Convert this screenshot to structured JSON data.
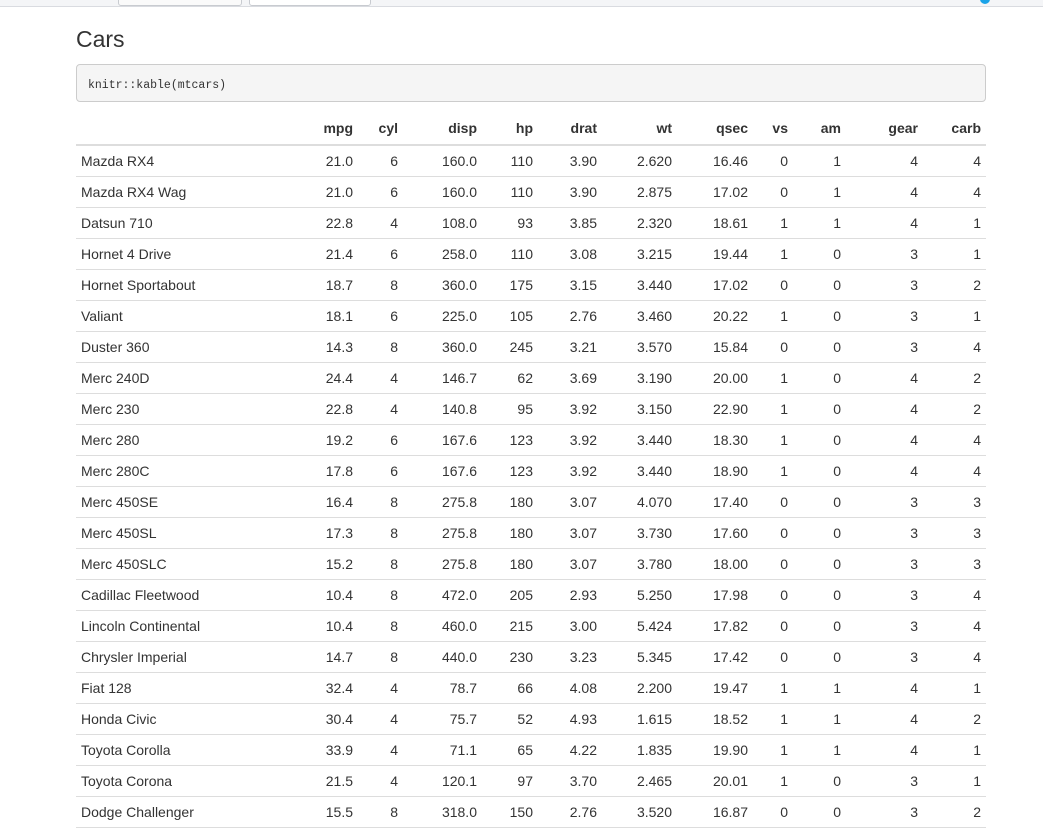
{
  "page": {
    "title": "Cars",
    "code": "knitr::kable(mtcars)"
  },
  "table": {
    "columns": [
      "",
      "mpg",
      "cyl",
      "disp",
      "hp",
      "drat",
      "wt",
      "qsec",
      "vs",
      "am",
      "gear",
      "carb"
    ],
    "rows": [
      [
        "Mazda RX4",
        "21.0",
        "6",
        "160.0",
        "110",
        "3.90",
        "2.620",
        "16.46",
        "0",
        "1",
        "4",
        "4"
      ],
      [
        "Mazda RX4 Wag",
        "21.0",
        "6",
        "160.0",
        "110",
        "3.90",
        "2.875",
        "17.02",
        "0",
        "1",
        "4",
        "4"
      ],
      [
        "Datsun 710",
        "22.8",
        "4",
        "108.0",
        "93",
        "3.85",
        "2.320",
        "18.61",
        "1",
        "1",
        "4",
        "1"
      ],
      [
        "Hornet 4 Drive",
        "21.4",
        "6",
        "258.0",
        "110",
        "3.08",
        "3.215",
        "19.44",
        "1",
        "0",
        "3",
        "1"
      ],
      [
        "Hornet Sportabout",
        "18.7",
        "8",
        "360.0",
        "175",
        "3.15",
        "3.440",
        "17.02",
        "0",
        "0",
        "3",
        "2"
      ],
      [
        "Valiant",
        "18.1",
        "6",
        "225.0",
        "105",
        "2.76",
        "3.460",
        "20.22",
        "1",
        "0",
        "3",
        "1"
      ],
      [
        "Duster 360",
        "14.3",
        "8",
        "360.0",
        "245",
        "3.21",
        "3.570",
        "15.84",
        "0",
        "0",
        "3",
        "4"
      ],
      [
        "Merc 240D",
        "24.4",
        "4",
        "146.7",
        "62",
        "3.69",
        "3.190",
        "20.00",
        "1",
        "0",
        "4",
        "2"
      ],
      [
        "Merc 230",
        "22.8",
        "4",
        "140.8",
        "95",
        "3.92",
        "3.150",
        "22.90",
        "1",
        "0",
        "4",
        "2"
      ],
      [
        "Merc 280",
        "19.2",
        "6",
        "167.6",
        "123",
        "3.92",
        "3.440",
        "18.30",
        "1",
        "0",
        "4",
        "4"
      ],
      [
        "Merc 280C",
        "17.8",
        "6",
        "167.6",
        "123",
        "3.92",
        "3.440",
        "18.90",
        "1",
        "0",
        "4",
        "4"
      ],
      [
        "Merc 450SE",
        "16.4",
        "8",
        "275.8",
        "180",
        "3.07",
        "4.070",
        "17.40",
        "0",
        "0",
        "3",
        "3"
      ],
      [
        "Merc 450SL",
        "17.3",
        "8",
        "275.8",
        "180",
        "3.07",
        "3.730",
        "17.60",
        "0",
        "0",
        "3",
        "3"
      ],
      [
        "Merc 450SLC",
        "15.2",
        "8",
        "275.8",
        "180",
        "3.07",
        "3.780",
        "18.00",
        "0",
        "0",
        "3",
        "3"
      ],
      [
        "Cadillac Fleetwood",
        "10.4",
        "8",
        "472.0",
        "205",
        "2.93",
        "5.250",
        "17.98",
        "0",
        "0",
        "3",
        "4"
      ],
      [
        "Lincoln Continental",
        "10.4",
        "8",
        "460.0",
        "215",
        "3.00",
        "5.424",
        "17.82",
        "0",
        "0",
        "3",
        "4"
      ],
      [
        "Chrysler Imperial",
        "14.7",
        "8",
        "440.0",
        "230",
        "3.23",
        "5.345",
        "17.42",
        "0",
        "0",
        "3",
        "4"
      ],
      [
        "Fiat 128",
        "32.4",
        "4",
        "78.7",
        "66",
        "4.08",
        "2.200",
        "19.47",
        "1",
        "1",
        "4",
        "1"
      ],
      [
        "Honda Civic",
        "30.4",
        "4",
        "75.7",
        "52",
        "4.93",
        "1.615",
        "18.52",
        "1",
        "1",
        "4",
        "2"
      ],
      [
        "Toyota Corolla",
        "33.9",
        "4",
        "71.1",
        "65",
        "4.22",
        "1.835",
        "19.90",
        "1",
        "1",
        "4",
        "1"
      ],
      [
        "Toyota Corona",
        "21.5",
        "4",
        "120.1",
        "97",
        "3.70",
        "2.465",
        "20.01",
        "1",
        "0",
        "3",
        "1"
      ],
      [
        "Dodge Challenger",
        "15.5",
        "8",
        "318.0",
        "150",
        "2.76",
        "3.520",
        "16.87",
        "0",
        "0",
        "3",
        "2"
      ]
    ]
  }
}
